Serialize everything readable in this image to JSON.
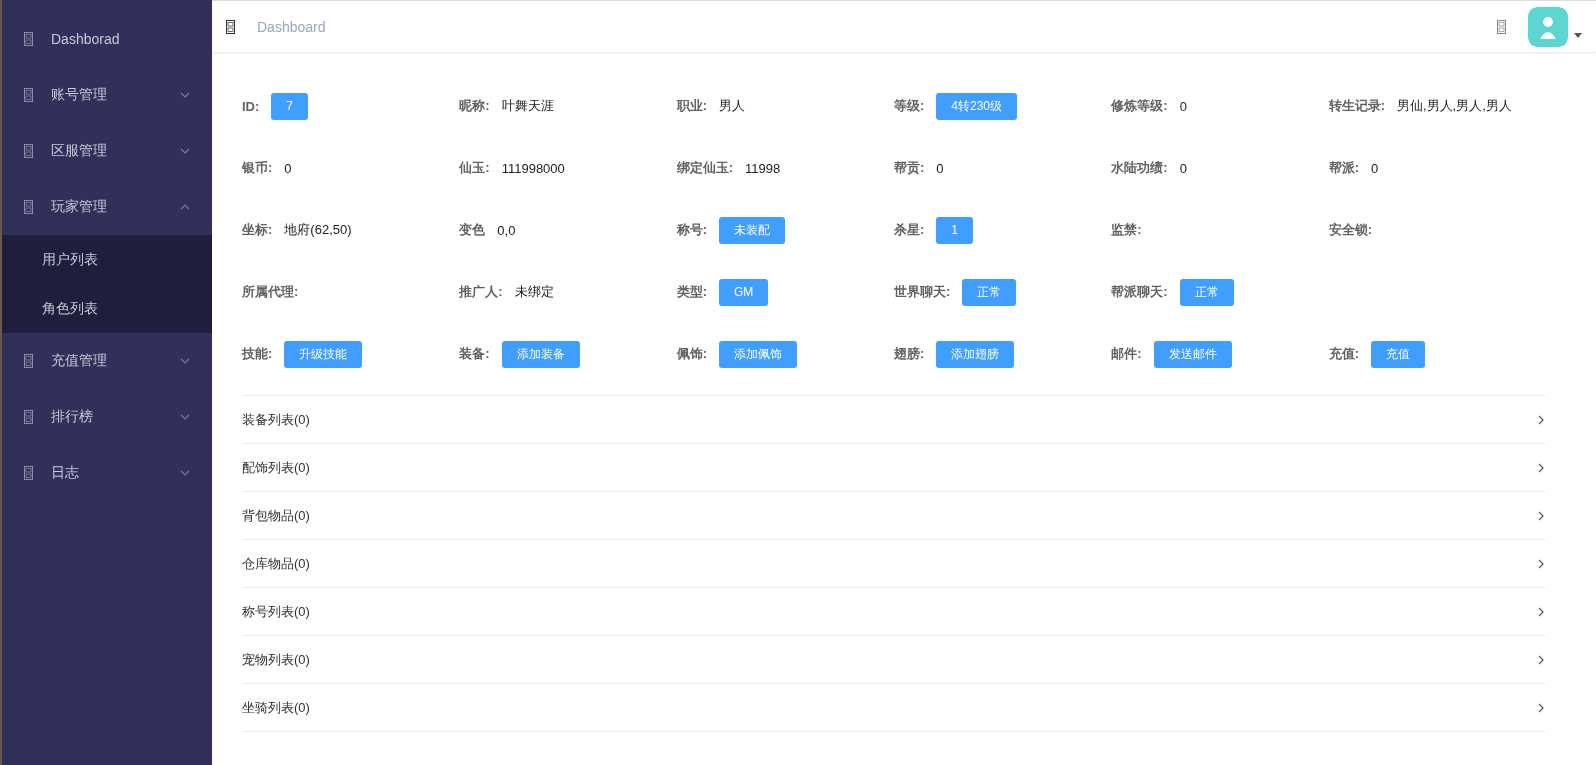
{
  "sidebar": {
    "items": [
      {
        "label": "Dashborad"
      },
      {
        "label": "账号管理",
        "expanded": false
      },
      {
        "label": "区服管理",
        "expanded": false
      },
      {
        "label": "玩家管理",
        "expanded": true,
        "children": [
          {
            "label": "用户列表"
          },
          {
            "label": "角色列表"
          }
        ]
      },
      {
        "label": "充值管理",
        "expanded": false
      },
      {
        "label": "排行榜",
        "expanded": false
      },
      {
        "label": "日志",
        "expanded": false
      }
    ]
  },
  "header": {
    "breadcrumb": "Dashboard"
  },
  "info_rows": [
    [
      {
        "label": "ID:",
        "kind": "button",
        "value": "7"
      },
      {
        "label": "昵称:",
        "kind": "text",
        "value": "叶舞天涯"
      },
      {
        "label": "职业:",
        "kind": "text",
        "value": "男人"
      },
      {
        "label": "等级:",
        "kind": "button",
        "value": "4转230级"
      },
      {
        "label": "修炼等级:",
        "kind": "text",
        "value": "0"
      },
      {
        "label": "转生记录:",
        "kind": "text",
        "value": "男仙,男人,男人,男人"
      }
    ],
    [
      {
        "label": "银币:",
        "kind": "text",
        "value": "0"
      },
      {
        "label": "仙玉:",
        "kind": "text",
        "value": "111998000"
      },
      {
        "label": "绑定仙玉:",
        "kind": "text",
        "value": "11998"
      },
      {
        "label": "帮贡:",
        "kind": "text",
        "value": "0"
      },
      {
        "label": "水陆功绩:",
        "kind": "text",
        "value": "0"
      },
      {
        "label": "帮派:",
        "kind": "text",
        "value": "0"
      }
    ],
    [
      {
        "label": "坐标:",
        "kind": "text",
        "value": "地府(62,50)"
      },
      {
        "label": "变色",
        "kind": "text",
        "value": "0,0"
      },
      {
        "label": "称号:",
        "kind": "button",
        "value": "未装配"
      },
      {
        "label": "杀星:",
        "kind": "button",
        "value": "1"
      },
      {
        "label": "监禁:"
      },
      {
        "label": "安全锁:"
      }
    ],
    [
      {
        "label": "所属代理:"
      },
      {
        "label": "推广人:",
        "kind": "text",
        "value": "未绑定"
      },
      {
        "label": "类型:",
        "kind": "button",
        "value": "GM"
      },
      {
        "label": "世界聊天:",
        "kind": "button",
        "value": "正常"
      },
      {
        "label": "帮派聊天:",
        "kind": "button",
        "value": "正常"
      }
    ],
    [
      {
        "label": "技能:",
        "kind": "button",
        "value": "升级技能"
      },
      {
        "label": "装备:",
        "kind": "button",
        "value": "添加装备"
      },
      {
        "label": "佩饰:",
        "kind": "button",
        "value": "添加佩饰"
      },
      {
        "label": "翅膀:",
        "kind": "button",
        "value": "添加翅膀"
      },
      {
        "label": "邮件:",
        "kind": "button",
        "value": "发送邮件"
      },
      {
        "label": "充值:",
        "kind": "button",
        "value": "充值"
      }
    ]
  ],
  "sections": [
    {
      "title": "装备列表(0)",
      "expanded": false
    },
    {
      "title": "配饰列表(0)",
      "expanded": false
    },
    {
      "title": "背包物品(0)",
      "expanded": false
    },
    {
      "title": "仓库物品(0)",
      "expanded": false
    },
    {
      "title": "称号列表(0)",
      "expanded": false
    },
    {
      "title": "宠物列表(0)",
      "expanded": false
    },
    {
      "title": "坐骑列表(0)",
      "expanded": false
    }
  ]
}
